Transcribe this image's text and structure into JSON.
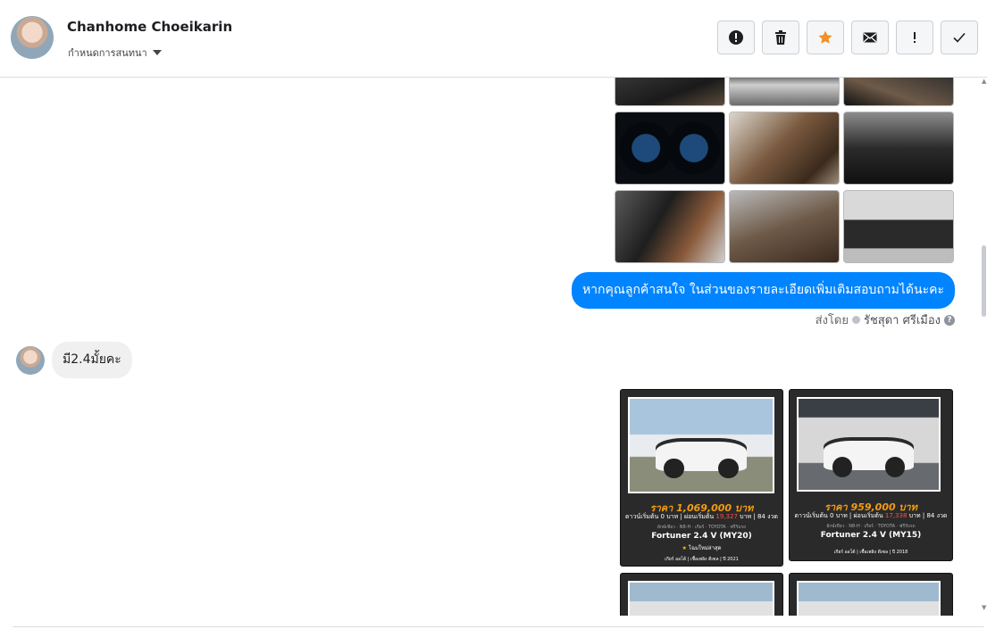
{
  "header": {
    "contact_name": "Chanhome Choeikarin",
    "label_dropdown": "กำหนดการสนทนา",
    "toolbar": [
      {
        "icon": "exclamation-circle-icon"
      },
      {
        "icon": "trash-icon"
      },
      {
        "icon": "star-icon",
        "color": "#f28f26"
      },
      {
        "icon": "envelope-icon"
      },
      {
        "icon": "exclamation-icon"
      },
      {
        "icon": "check-icon"
      }
    ]
  },
  "conversation": {
    "outgoing_message": "หากคุณลูกค้าสนใจ ในส่วนของรายละเอียดเพิ่มเติมสอบถามได้นะคะ",
    "sent_by_prefix": "ส่งโดย",
    "sent_by_name": "รัชสุดา ศรีเมือง",
    "incoming_message": "มี2.4มั้ยคะ",
    "accent_color": "#0084ff",
    "listings": [
      {
        "price": "ราคา 1,069,000 บาท",
        "terms_a": "ดาวน์เริ่มต้น 0 บาท | ผ่อนเริ่มต้น",
        "terms_red": "19,327",
        "terms_b": "บาท | 84 งวด",
        "sub": "ยักษ์เขียว · N8-H · เกียร์ · TOYOTA · ฟรีรับรถ",
        "model": "Fortuner 2.4 V (MY20)",
        "badge": "โฉมใหม่ล่าสุด",
        "foot": "เกียร์ ออโต้ | เชื้อเพลิง ดีเซล | ปี 2021"
      },
      {
        "price": "ราคา 959,000 บาท",
        "terms_a": "ดาวน์เริ่มต้น 0 บาท | ผ่อนเริ่มต้น",
        "terms_red": "17,338",
        "terms_b": "บาท | 84 งวด",
        "sub": "ยักษ์เขียว · N8-H · เกียร์ · TOYOTA · ฟรีรับรถ",
        "model": "Fortuner 2.4 V (MY15)",
        "foot": "เกียร์ ออโต้ | เชื้อเพลิง ดีเซล | ปี 2018"
      }
    ]
  }
}
